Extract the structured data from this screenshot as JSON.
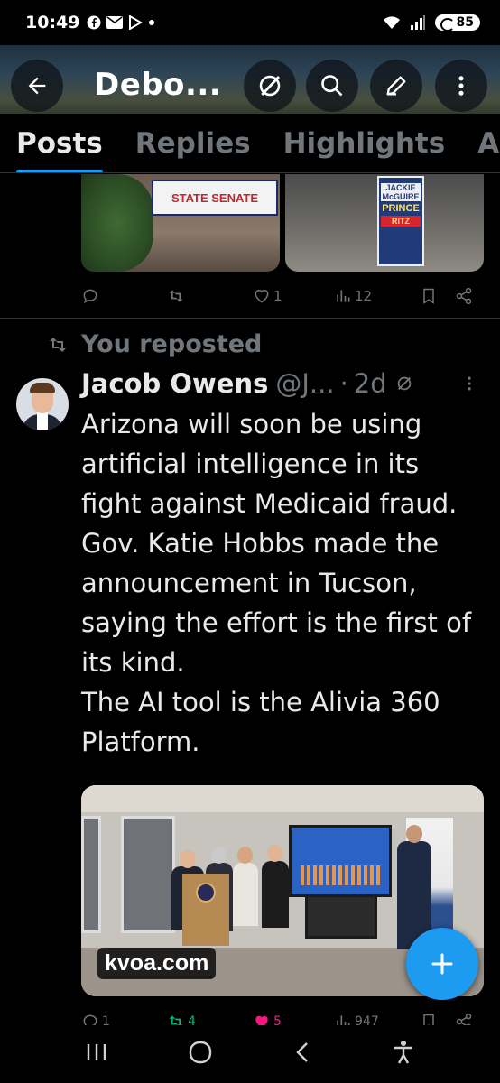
{
  "status_bar": {
    "time": "10:49",
    "battery": "85"
  },
  "header": {
    "title": "Debo...",
    "icons": [
      "back-arrow-icon",
      "grok-icon",
      "search-icon",
      "edit-icon",
      "more-vertical-icon"
    ]
  },
  "tabs": [
    {
      "label": "Posts",
      "active": true
    },
    {
      "label": "Replies",
      "active": false
    },
    {
      "label": "Highlights",
      "active": false
    },
    {
      "label": "Ar",
      "active": false
    }
  ],
  "previous_post": {
    "media_signs": {
      "left": "STATE SENATE",
      "right_lines": [
        "JACKIE McGUIRE",
        "PRINCE",
        "RITZ"
      ]
    },
    "actions": {
      "replies": "",
      "reposts": "",
      "likes": "1",
      "views": "12"
    }
  },
  "repost_label": "You reposted",
  "post": {
    "author_name": "Jacob Owens",
    "handle": "@J...",
    "time": "2d",
    "body": "Arizona will soon be using artificial intelligence in its fight against Medicaid fraud. Gov. Katie Hobbs made the announcement in Tucson, saying the effort is the first of its kind.\nThe AI tool is the Alivia 360 Platform.",
    "card": {
      "domain": "kvoa.com"
    },
    "actions": {
      "replies": "1",
      "reposts": "4",
      "likes": "5",
      "views": "947"
    }
  },
  "colors": {
    "accent": "#1d9bf0",
    "muted": "#71767b",
    "text": "#e7e9ea",
    "repost_green": "#00ba7c",
    "like_pink": "#f91880"
  }
}
